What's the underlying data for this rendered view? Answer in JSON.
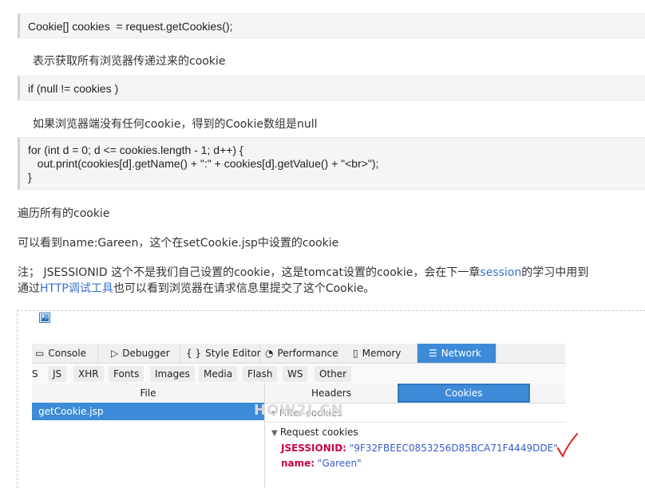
{
  "code_blocks": [
    {
      "lines": [
        "Cookie[] cookies  = request.getCookies();"
      ]
    },
    {
      "lines": [
        "if (null != cookies )"
      ]
    },
    {
      "lines": [
        "for (int d = 0; d <= cookies.length - 1; d++) {",
        "   out.print(cookies[d].getName() + \":\" + cookies[d].getValue() + \"<br>\");",
        "}"
      ]
    }
  ],
  "paragraphs": {
    "p1": "表示获取所有浏览器传递过来的cookie",
    "p2": "如果浏览器端没有任何cookie，得到的Cookie数组是null",
    "p3": "遍历所有的cookie",
    "p4": "可以看到name:Gareen，这个在setCookie.jsp中设置的cookie",
    "p5_a": "注； JSESSIONID 这个不是我们自己设置的cookie，这是tomcat设置的cookie，会在下一章",
    "p5_link": "session",
    "p5_b": "的学习中用到",
    "p6_a": "通过",
    "p6_link": "HTTP调试工具",
    "p6_b": "也可以看到浏览器在请求信息里提交了这个Cookie。"
  },
  "devtools": {
    "tabs": [
      {
        "icon": "▭",
        "label": "Console"
      },
      {
        "icon": "▷",
        "label": "Debugger"
      },
      {
        "icon": "{ }",
        "label": "Style Editor"
      },
      {
        "icon": "◔",
        "label": "Performance"
      },
      {
        "icon": "▯",
        "label": "Memory"
      },
      {
        "icon": "☰",
        "label": "Network"
      }
    ],
    "active_tab": "Network",
    "filters": [
      "S",
      "JS",
      "XHR",
      "Fonts",
      "Images",
      "Media",
      "Flash",
      "WS",
      "Other"
    ],
    "file_column": "File",
    "request": "getCookie.jsp",
    "subtabs": [
      "Headers",
      "Cookies"
    ],
    "active_subtab": "Cookies",
    "filter_placeholder": "Filter cookies",
    "section_label": "Request cookies",
    "cookies": [
      {
        "key": "JSESSIONID:",
        "value": "\"9F32FBEEC0853256D85BCA71F4449DDE\""
      },
      {
        "key": "name:",
        "value": "\"Gareen\""
      }
    ],
    "watermark": "HOW2J.CN",
    "accent_color": "#3d8bd8"
  }
}
